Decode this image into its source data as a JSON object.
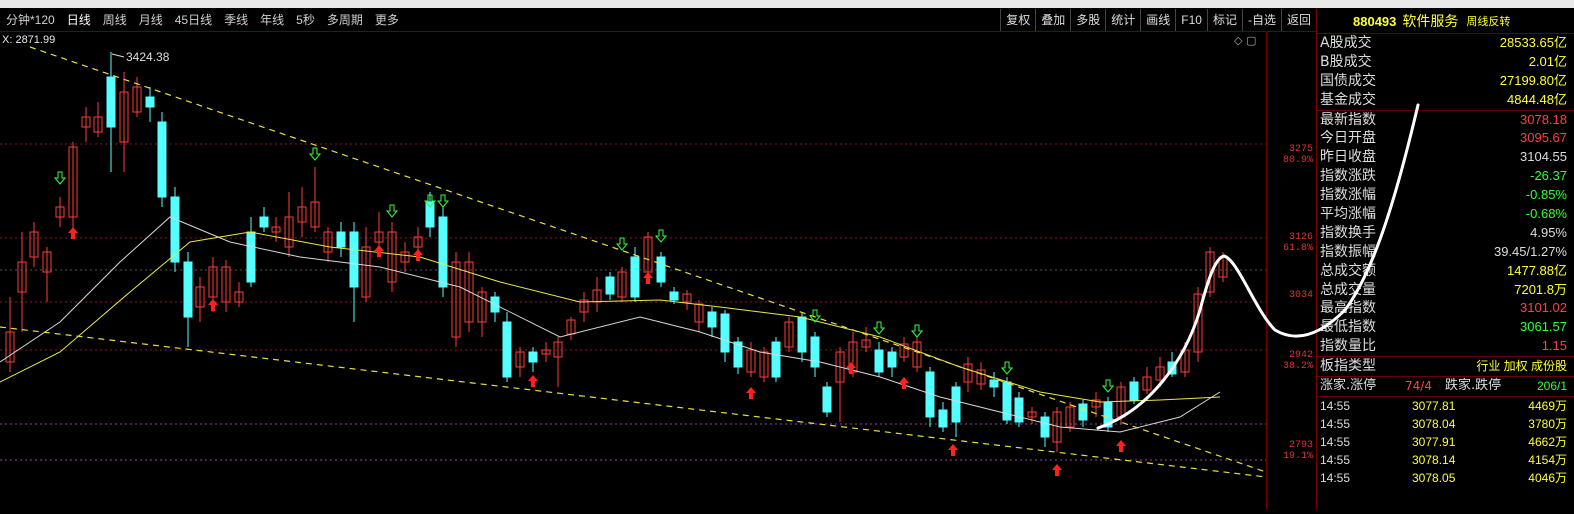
{
  "toolbar": {
    "tabs": [
      "分钟*120",
      "日线",
      "周线",
      "月线",
      "45日线",
      "季线",
      "年线",
      "5秒",
      "多周期",
      "更多"
    ],
    "active_tab": "日线",
    "right_buttons": [
      "复权",
      "叠加",
      "多股",
      "统计",
      "画线",
      "F10",
      "标记",
      "-自选",
      "返回"
    ]
  },
  "chart": {
    "ma_label": "X: 2871.99",
    "high_marker": "3424.38",
    "axis": [
      {
        "price": "3275",
        "pct": "80.9%"
      },
      {
        "price": "3126",
        "pct": "61.8%"
      },
      {
        "price": "3034",
        "pct": ""
      },
      {
        "price": "2942",
        "pct": "38.2%"
      },
      {
        "price": "2793",
        "pct": "19.1%"
      }
    ],
    "colors": {
      "up": "#ff3c3c",
      "down": "#54ffff",
      "ma1": "#d8d8d8",
      "ma2": "#e8e84a",
      "trend": "#e8e040"
    }
  },
  "panel": {
    "code": "880493",
    "name": "软件服务",
    "tag": "周线反转",
    "volume_rows": [
      {
        "label": "A股成交",
        "value": "28533.65亿"
      },
      {
        "label": "B股成交",
        "value": "2.01亿"
      },
      {
        "label": "国债成交",
        "value": "27199.80亿"
      },
      {
        "label": "基金成交",
        "value": "4844.48亿"
      }
    ],
    "index_rows": [
      {
        "label": "最新指数",
        "value": "3078.18",
        "color": "red"
      },
      {
        "label": "今日开盘",
        "value": "3095.67",
        "color": "red"
      },
      {
        "label": "昨日收盘",
        "value": "3104.55",
        "color": "white"
      },
      {
        "label": "指数涨跌",
        "value": "-26.37",
        "color": "green"
      },
      {
        "label": "指数涨幅",
        "value": "-0.85%",
        "color": "green"
      },
      {
        "label": "平均涨幅",
        "value": "-0.68%",
        "color": "green"
      },
      {
        "label": "指数换手",
        "value": "4.95%",
        "color": "white"
      },
      {
        "label": "指数振幅",
        "value": "39.45/1.27%",
        "color": "white"
      },
      {
        "label": "总成交额",
        "value": "1477.88亿",
        "color": "yellow"
      },
      {
        "label": "总成交量",
        "value": "7201.8万",
        "color": "yellow"
      },
      {
        "label": "最高指数",
        "value": "3101.02",
        "color": "red"
      },
      {
        "label": "最低指数",
        "value": "3061.57",
        "color": "green"
      },
      {
        "label": "指数量比",
        "value": "1.15",
        "color": "red"
      }
    ],
    "type_label": "板指类型",
    "type_value": "行业 加权 成份股",
    "breadth_label": "涨家.涨停",
    "breadth_up": "74/4",
    "breadth_down_label": "跌家.跌停",
    "breadth_down": "206/1",
    "ticks": [
      {
        "time": "14:55",
        "price": "3077.81",
        "vol": "4469万"
      },
      {
        "time": "14:55",
        "price": "3078.04",
        "vol": "3780万"
      },
      {
        "time": "14:55",
        "price": "3077.91",
        "vol": "4662万"
      },
      {
        "time": "14:55",
        "price": "3078.14",
        "vol": "4154万"
      },
      {
        "time": "14:55",
        "price": "3078.05",
        "vol": "4046万"
      }
    ]
  }
}
